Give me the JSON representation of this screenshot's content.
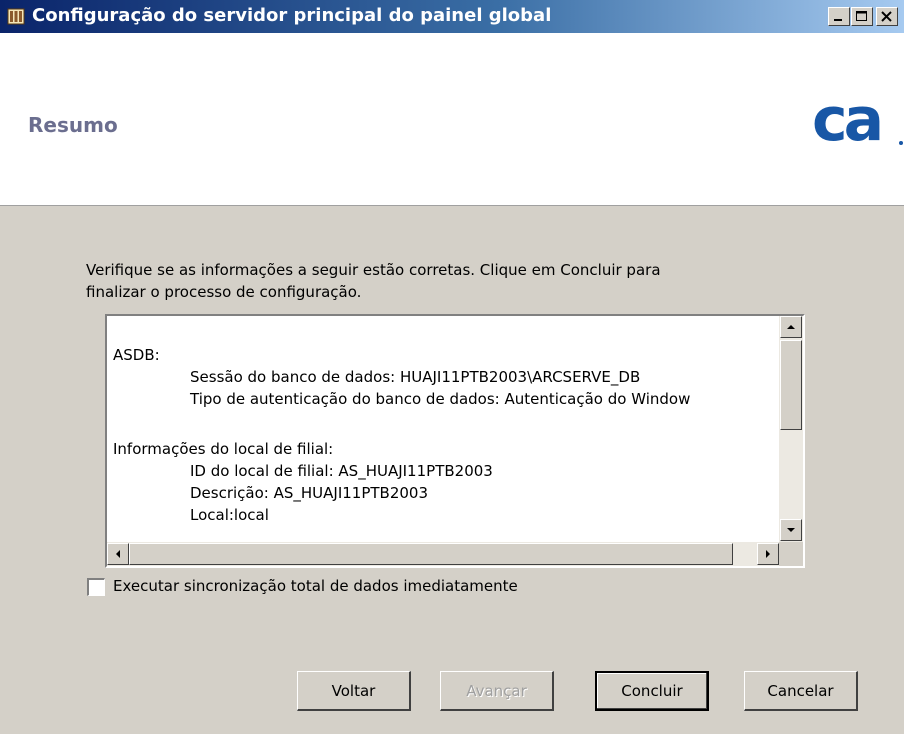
{
  "window": {
    "title": "Configuração do servidor principal do painel global",
    "minimize_glyph": "_",
    "maximize_glyph": "□",
    "close_glyph": "×"
  },
  "header": {
    "title": "Resumo",
    "logo_text": "ca",
    "logo_color": "#1857a6"
  },
  "intro": {
    "line1": "Verifique se as informações a seguir estão corretas. Clique em Concluir para",
    "line2": "finalizar o processo de configuração."
  },
  "summary": {
    "lines": [
      "ASDB:",
      "Sessão do banco de dados: HUAJI11PTB2003\\ARCSERVE_DB",
      "Tipo de autenticação do banco de dados: Autenticação do Window",
      "Informações do local de filial:",
      "ID do local de filial: AS_HUAJI11PTB2003",
      "Descrição: AS_HUAJI11PTB2003",
      "Local:local"
    ]
  },
  "scroll": {
    "up_icon": "scroll-up-arrow",
    "down_icon": "scroll-down-arrow",
    "left_icon": "scroll-left-arrow",
    "right_icon": "scroll-right-arrow"
  },
  "options": {
    "full_sync_label": "Executar sincronização total de dados imediatamente",
    "full_sync_checked": false
  },
  "buttons": {
    "back": "Voltar",
    "next": "Avançar",
    "finish": "Concluir",
    "cancel": "Cancelar"
  }
}
